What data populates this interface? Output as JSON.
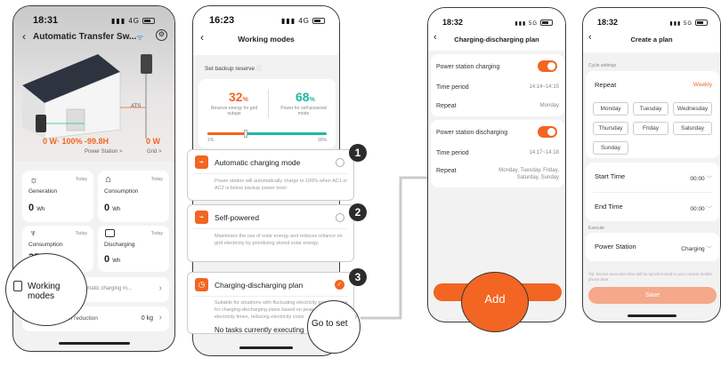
{
  "colors": {
    "accent": "#f26522",
    "teal": "#1fb8a3"
  },
  "screen1": {
    "time": "18:31",
    "signal": "4G",
    "title": "Automatic Transfer Sw...",
    "ats_label": "ATS",
    "power_station_value": "0 W· 100% -99.8H",
    "grid_value": "0 W",
    "power_station_link": "Power Station >",
    "grid_link": "Grid >",
    "tiles": [
      {
        "label": "Generation",
        "today": "Today",
        "value": "0",
        "unit": "Wh",
        "icon": "sun-icon"
      },
      {
        "label": "Consumption",
        "today": "Today",
        "value": "0",
        "unit": "Wh",
        "icon": "home-icon"
      },
      {
        "label": "Consumption",
        "today": "Today",
        "value": "37.0",
        "unit": "Wh",
        "icon": "pylon-icon"
      },
      {
        "label": "Discharging",
        "today": "Today",
        "value": "0",
        "unit": "Wh",
        "icon": "battery-icon"
      }
    ],
    "working_modes_label": "Working modes",
    "working_modes_value": "Automatic charging m...",
    "bottom_row_label": "Emission reduction",
    "bottom_row_value": "0 kg"
  },
  "screen2": {
    "time": "16:23",
    "signal": "4G",
    "title": "Working modes",
    "backup_label": "Set backup reserve",
    "left_pct": "32",
    "left_desc": "Reserve energy for grid outage",
    "right_pct": "68",
    "right_desc": "Power for self-powered mode",
    "slider_min": "1%",
    "slider_max": "90%",
    "slider_value": 0.32,
    "modes": [
      {
        "title": "Automatic charging mode",
        "desc": "Power station will automatically charge to 100% when AC1 or AC2 is below backup power level",
        "callout": "1"
      },
      {
        "title": "Self-powered",
        "desc": "Maximizes the use of solar energy and reduces reliance on grid electricity by prioritizing stored solar energy.",
        "callout": "2"
      },
      {
        "title": "Charging-discharging plan",
        "desc": "Suitable for situations with fluctuating electricity prices, allows for charging-discharging plans based on peak and off-peak electricity times, reducing electricity costs",
        "callout": "3"
      }
    ],
    "no_tasks": "No tasks currently executing",
    "go_to_set": "Go to set"
  },
  "screen3": {
    "time": "18:32",
    "signal": "5G",
    "title": "Charging-discharging plan",
    "charging_label": "Power station charging",
    "charging_period_label": "Time period",
    "charging_period": "14:14~14:15",
    "charging_repeat_label": "Repeat",
    "charging_repeat": "Monday",
    "discharging_label": "Power station discharging",
    "discharging_period_label": "Time period",
    "discharging_period": "14:17~14:18",
    "discharging_repeat_label": "Repeat",
    "discharging_repeat": "Monday, Tuesday, Friday, Saturday, Sunday",
    "add_button": "Add"
  },
  "screen4": {
    "time": "18:32",
    "signal": "5G",
    "title": "Create a plan",
    "cycle_settings": "Cycle settings",
    "repeat_label": "Repeat",
    "repeat_value": "Weekly",
    "days": [
      "Monday",
      "Tuesday",
      "Wednesday",
      "Thursday",
      "Friday",
      "Saturday",
      "Sunday"
    ],
    "start_label": "Start Time",
    "start_value": "00:00",
    "end_label": "End Time",
    "end_value": "00:00",
    "execute_label": "Execute",
    "power_station_label": "Power Station",
    "power_station_value": "Charging",
    "tip": "Tip: Device execution time will be synchronized to your current mobile phone time.",
    "save_button": "Save"
  }
}
